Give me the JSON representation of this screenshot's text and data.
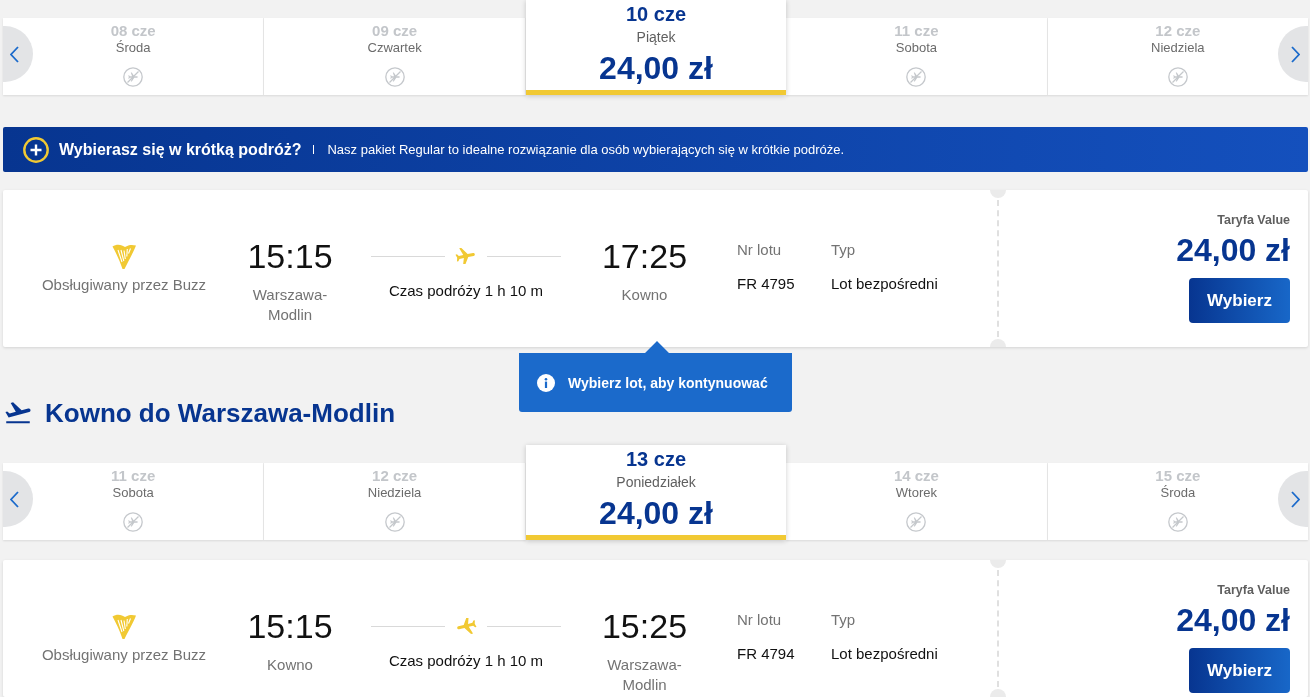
{
  "outbound": {
    "date_carousel": {
      "days": [
        {
          "date": "08 cze",
          "weekday": "Środa",
          "selected": false,
          "kind": "no_flights"
        },
        {
          "date": "09 cze",
          "weekday": "Czwartek",
          "selected": false,
          "kind": "no_flights"
        },
        {
          "date": "10 cze",
          "weekday": "Piątek",
          "selected": true,
          "kind": "fare",
          "price": "24,00 zł"
        },
        {
          "date": "11 cze",
          "weekday": "Sobota",
          "selected": false,
          "kind": "no_flights"
        },
        {
          "date": "12 cze",
          "weekday": "Niedziela",
          "selected": false,
          "kind": "no_flights"
        }
      ]
    },
    "promo_banner": {
      "title": "Wybierasz się w krótką podróż?",
      "text": "Nasz pakiet Regular to idealne rozwiązanie dla osób wybierających się w krótkie podróże."
    },
    "flights": [
      {
        "kind": "outbound",
        "operator": "Obsługiwany przez Buzz",
        "departure_time": "15:15",
        "departure_city": "Warszawa-Modlin",
        "duration": "Czas podróży 1 h 10 m",
        "arrival_time": "17:25",
        "arrival_city": "Kowno",
        "flight_number_label": "Nr lotu",
        "flight_number": "FR 4795",
        "type_label": "Typ",
        "type": "Lot bezpośredni",
        "fare_label": "Taryfa Value",
        "price": "24,00 zł",
        "button": "Wybierz"
      }
    ]
  },
  "tooltip": {
    "text": "Wybierz lot, aby kontynuować"
  },
  "return": {
    "heading": "Kowno do Warszawa-Modlin",
    "date_carousel": {
      "days": [
        {
          "date": "11 cze",
          "weekday": "Sobota",
          "selected": false,
          "kind": "no_flights"
        },
        {
          "date": "12 cze",
          "weekday": "Niedziela",
          "selected": false,
          "kind": "no_flights"
        },
        {
          "date": "13 cze",
          "weekday": "Poniedziałek",
          "selected": true,
          "kind": "fare",
          "price": "24,00 zł"
        },
        {
          "date": "14 cze",
          "weekday": "Wtorek",
          "selected": false,
          "kind": "no_flights"
        },
        {
          "date": "15 cze",
          "weekday": "Środa",
          "selected": false,
          "kind": "no_flights"
        }
      ]
    },
    "flights": [
      {
        "kind": "return",
        "operator": "Obsługiwany przez Buzz",
        "departure_time": "15:15",
        "departure_city": "Kowno",
        "duration": "Czas podróży 1 h 10 m",
        "arrival_time": "15:25",
        "arrival_city": "Warszawa-Modlin",
        "flight_number_label": "Nr lotu",
        "flight_number": "FR 4794",
        "type_label": "Typ",
        "type": "Lot bezpośredni",
        "fare_label": "Taryfa Value",
        "price": "24,00 zł",
        "button": "Wybierz"
      }
    ]
  }
}
